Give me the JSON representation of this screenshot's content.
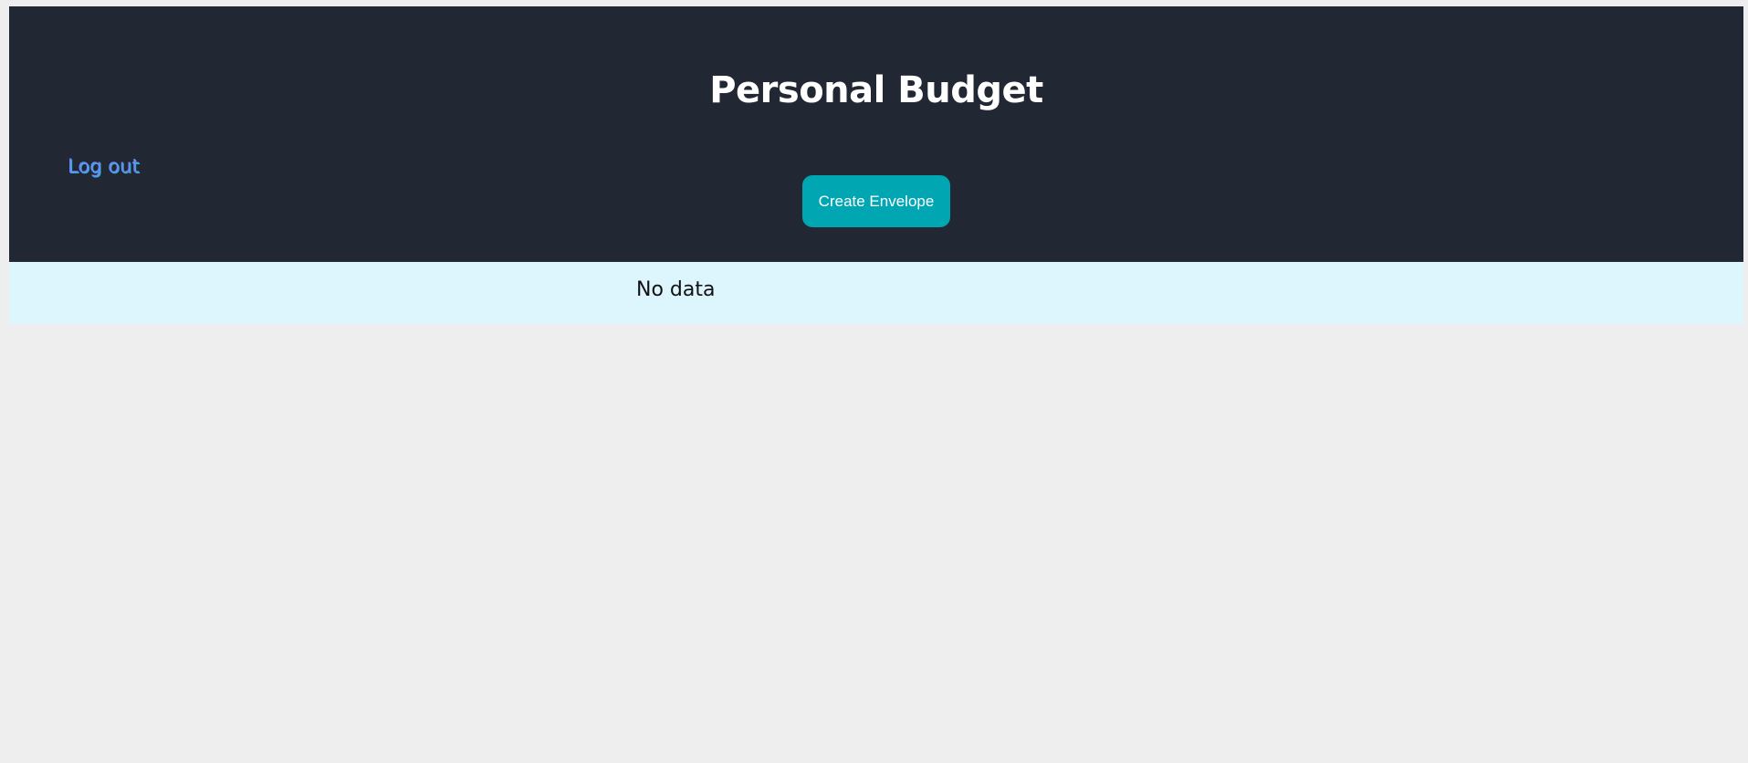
{
  "header": {
    "title": "Personal Budget",
    "logout_label": "Log out",
    "create_button_label": "Create Envelope"
  },
  "content": {
    "empty_message": "No data"
  },
  "colors": {
    "header_background": "#212833",
    "page_background": "#eeeeee",
    "content_background": "#ddf5fd",
    "button_background": "#00a6b1",
    "link_color": "#6f86ff"
  }
}
